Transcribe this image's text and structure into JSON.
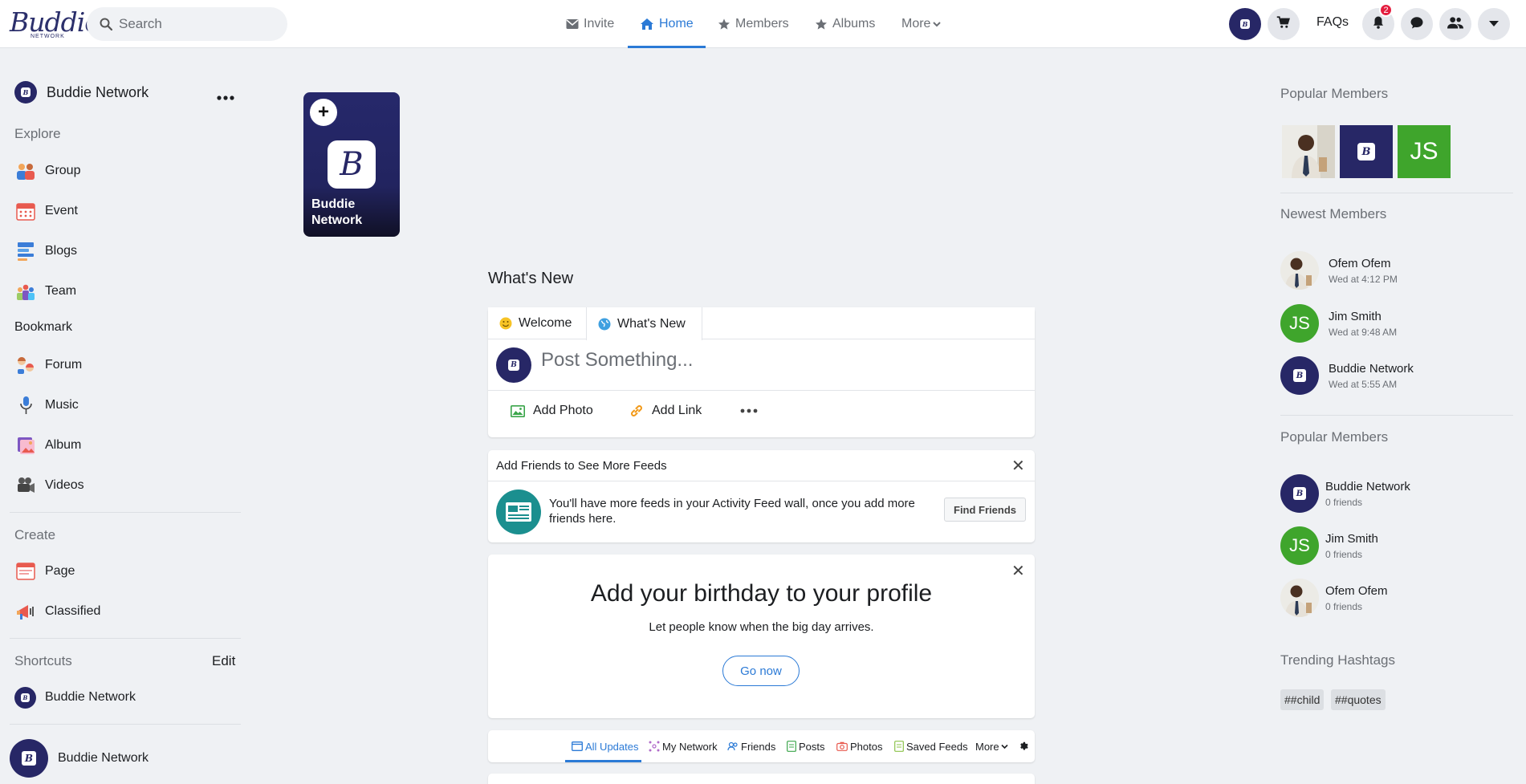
{
  "header": {
    "logo_text": "Buddie",
    "logo_sub": "NETWORK",
    "search_placeholder": "Search",
    "nav": [
      {
        "label": "Invite"
      },
      {
        "label": "Home"
      },
      {
        "label": "Members"
      },
      {
        "label": "Albums"
      },
      {
        "label": "More"
      }
    ],
    "faqs": "FAQs",
    "notification_count": "2"
  },
  "left_sidebar": {
    "profile_name": "Buddie Network",
    "explore_label": "Explore",
    "explore_items": [
      {
        "label": "Group",
        "icon": "group-icon"
      },
      {
        "label": "Event",
        "icon": "calendar-icon"
      },
      {
        "label": "Blogs",
        "icon": "blog-icon"
      },
      {
        "label": "Team",
        "icon": "team-icon"
      }
    ],
    "bookmark_label": "Bookmark",
    "bookmark_items": [
      {
        "label": "Forum",
        "icon": "forum-icon"
      },
      {
        "label": "Music",
        "icon": "music-icon"
      },
      {
        "label": "Album",
        "icon": "album-icon"
      },
      {
        "label": "Videos",
        "icon": "video-camera-icon"
      }
    ],
    "create_label": "Create",
    "create_items": [
      {
        "label": "Page",
        "icon": "page-icon"
      },
      {
        "label": "Classified",
        "icon": "classified-icon"
      }
    ],
    "shortcuts_label": "Shortcuts",
    "shortcuts_edit": "Edit",
    "shortcut_items": [
      {
        "label": "Buddie Network"
      }
    ],
    "bottom_profile": "Buddie Network"
  },
  "story": {
    "title": "Buddie Network",
    "add_label": "+"
  },
  "feed": {
    "title": "What's New",
    "tabs": [
      {
        "label": "Welcome",
        "icon": "smile-icon"
      },
      {
        "label": "What's New",
        "icon": "globe-icon"
      }
    ],
    "composer_placeholder": "Post Something...",
    "actions": [
      {
        "label": "Add Photo",
        "icon": "photo-icon"
      },
      {
        "label": "Add Link",
        "icon": "link-icon"
      }
    ],
    "add_friends": {
      "title": "Add Friends to See More Feeds",
      "text": "You'll have more feeds in your Activity Feed wall, once you add more friends here.",
      "button": "Find Friends"
    },
    "birthday": {
      "title": "Add your birthday to your profile",
      "subtitle": "Let people know when the big day arrives.",
      "button": "Go now"
    },
    "filter_tabs": [
      {
        "label": "All Updates",
        "icon": "all-updates-icon"
      },
      {
        "label": "My Network",
        "icon": "network-icon"
      },
      {
        "label": "Friends",
        "icon": "friends-icon"
      },
      {
        "label": "Posts",
        "icon": "posts-icon"
      },
      {
        "label": "Photos",
        "icon": "camera-icon"
      },
      {
        "label": "Saved Feeds",
        "icon": "saved-icon"
      },
      {
        "label": "More",
        "icon": "chevron-down-icon"
      }
    ]
  },
  "right_sidebar": {
    "popular_title": "Popular Members",
    "popular_tiles": [
      {
        "kind": "photo"
      },
      {
        "kind": "logo"
      },
      {
        "kind": "initials",
        "text": "JS"
      }
    ],
    "newest_title": "Newest Members",
    "newest": [
      {
        "name": "Ofem Ofem",
        "sub": "Wed at 4:12 PM",
        "avatar": "photo"
      },
      {
        "name": "Jim Smith",
        "sub": "Wed at 9:48 AM",
        "avatar": "JS"
      },
      {
        "name": "Buddie Network",
        "sub": "Wed at 5:55 AM",
        "avatar": "logo"
      }
    ],
    "popular2_title": "Popular Members",
    "popular2": [
      {
        "name": "Buddie Network",
        "sub": "0 friends",
        "avatar": "logo"
      },
      {
        "name": "Jim Smith",
        "sub": "0 friends",
        "avatar": "JS"
      },
      {
        "name": "Ofem Ofem",
        "sub": "0 friends",
        "avatar": "photo"
      }
    ],
    "hashtags_title": "Trending Hashtags",
    "hashtags": [
      "##child",
      "##quotes"
    ]
  },
  "colors": {
    "brand": "#272766",
    "accent": "#2b7ad6",
    "initials_green": "#3fa52c",
    "badge_red": "#e41e3f"
  }
}
